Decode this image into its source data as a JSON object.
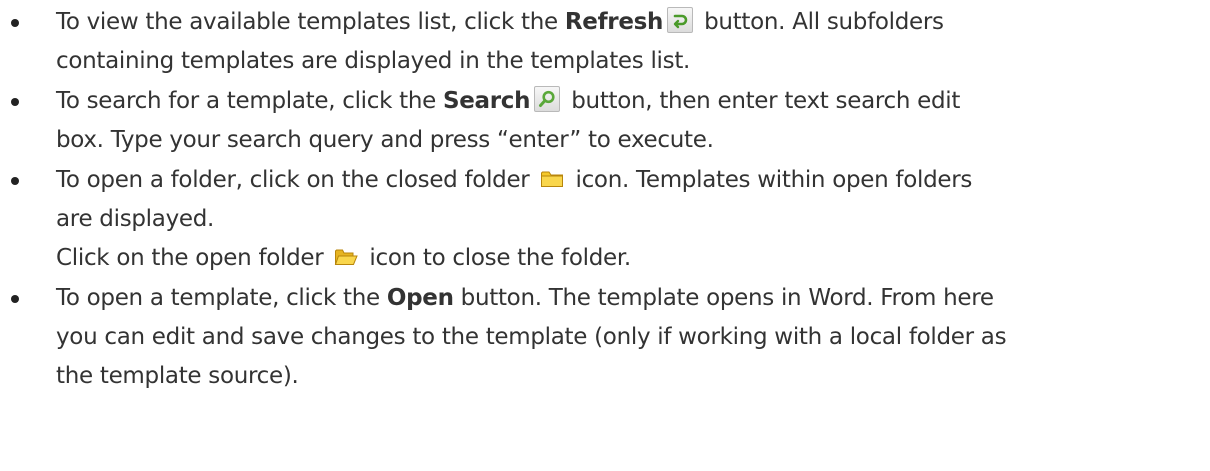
{
  "bullets": [
    {
      "segments": {
        "a": "To view the available templates list, click the ",
        "b": "Refresh",
        "c": " button.  All subfolders",
        "d": "containing templates are displayed in the templates list."
      },
      "icon": "refresh-icon"
    },
    {
      "segments": {
        "a": "To search for a template, click the ",
        "b": "Search",
        "c": " button, then enter text search edit",
        "d": "box. Type your search query and press “enter” to execute."
      },
      "icon": "search-icon"
    },
    {
      "segments": {
        "a": "To open a folder, click on the closed folder ",
        "b": " icon. Templates within open folders",
        "c": "are displayed.",
        "d": "Click on the open folder ",
        "e": " icon to close the folder."
      },
      "icons": [
        "closed-folder-icon",
        "open-folder-icon"
      ]
    },
    {
      "segments": {
        "a": "To open a template, click the ",
        "b": "Open",
        "c": " button. The template opens in Word. From here",
        "d": "you can edit and save changes to the template (only if working with a local folder as",
        "e": "the template source)."
      }
    }
  ],
  "colors": {
    "text": "#333333",
    "refresh_arrow": "#4a9a2a",
    "search_lens": "#5aa83a",
    "folder": "#f0c419"
  }
}
